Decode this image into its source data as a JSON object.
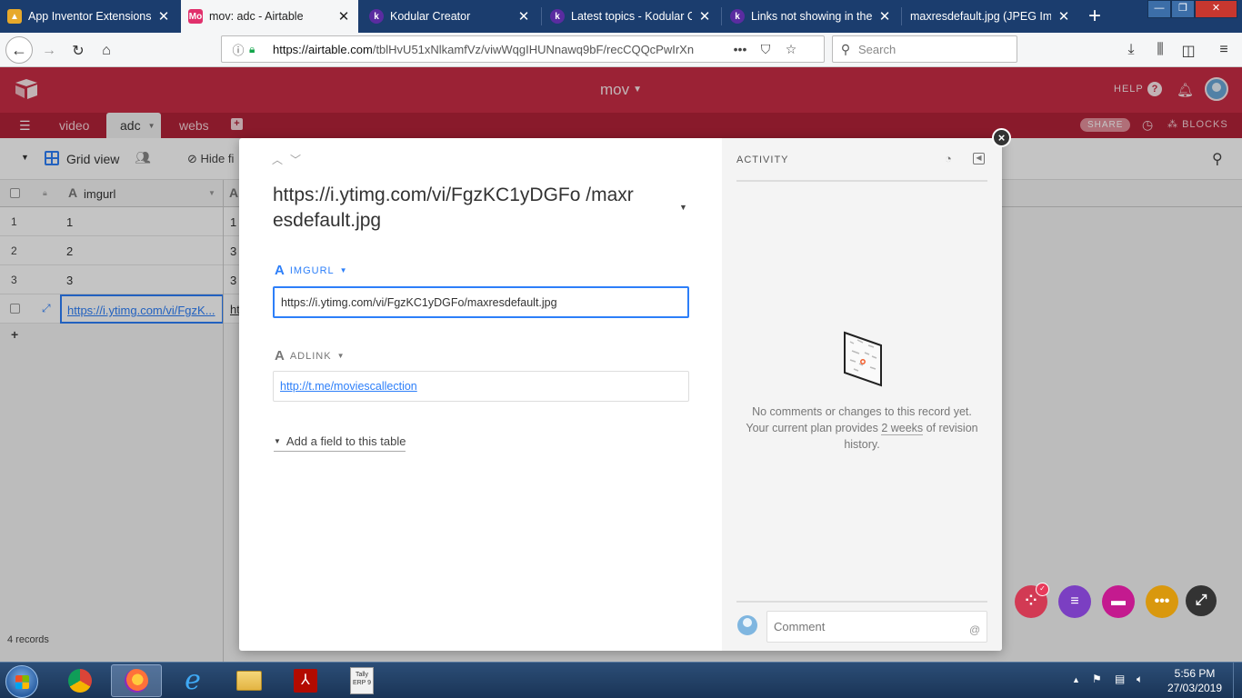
{
  "browser": {
    "tabs": [
      {
        "title": "App Inventor Extensions |",
        "icon": "app-inventor-icon",
        "fav_text": "",
        "color": "#e7a92a"
      },
      {
        "title": "mov: adc - Airtable",
        "icon": "airtable-mo-icon",
        "fav_text": "Mo",
        "color": "#e1306c"
      },
      {
        "title": "Kodular Creator",
        "icon": "kodular-icon",
        "fav_text": "k",
        "color": "#5a2ca0"
      },
      {
        "title": "Latest topics - Kodular Co",
        "icon": "kodular-icon",
        "fav_text": "k",
        "color": "#5a2ca0"
      },
      {
        "title": "Links not showing in the a",
        "icon": "kodular-icon",
        "fav_text": "k",
        "color": "#5a2ca0"
      },
      {
        "title": "maxresdefault.jpg (JPEG Imag",
        "icon": "image-icon",
        "fav_text": "",
        "color": "#1b3d6e"
      }
    ],
    "url_host": "https://airtable.com",
    "url_path": "/tblHvU51xNlkamfVz/viwWqgIHUNnawq9bF/recCQQcPwIrXn",
    "search_placeholder": "Search"
  },
  "airtable": {
    "base_name": "mov",
    "help_label": "HELP",
    "table_tabs": [
      "video",
      "adc",
      "webs"
    ],
    "active_table": "adc",
    "share_label": "SHARE",
    "blocks_label": "BLOCKS",
    "view_name": "Grid view",
    "hide_fields_label": "Hide fi",
    "columns": [
      "imgurl"
    ],
    "rows": [
      {
        "num": "1",
        "imgurl": "1",
        "adlink": "1"
      },
      {
        "num": "2",
        "imgurl": "2",
        "adlink": "3"
      },
      {
        "num": "3",
        "imgurl": "3",
        "adlink": "3"
      },
      {
        "num": "",
        "imgurl": "https://i.ytimg.com/vi/FgzK...",
        "adlink": "ht"
      }
    ],
    "add_row_label": "+",
    "records_count": "4 records",
    "accent_color": "#ca2d45"
  },
  "record": {
    "title": "https://i.ytimg.com/vi/FgzKC1yDGFo /maxresdefault.jpg",
    "fields": [
      {
        "label": "IMGURL",
        "value": "https://i.ytimg.com/vi/FgzKC1yDGFo/maxresdefault.jpg"
      },
      {
        "label": "ADLINK",
        "value": "http://t.me/moviescallection"
      }
    ],
    "add_field_label": "Add a field to this table",
    "close_glyph": "×"
  },
  "activity": {
    "title": "ACTIVITY",
    "message_before": "No comments or changes to this record yet. Your current plan provides ",
    "message_link": "2 weeks",
    "message_after": " of revision history.",
    "comment_placeholder": "Comment",
    "at_symbol": "@"
  },
  "taskbar": {
    "time": "5:56 PM",
    "date": "27/03/2019",
    "tally_label": "ERP 9",
    "tally_brand": "Tally"
  }
}
